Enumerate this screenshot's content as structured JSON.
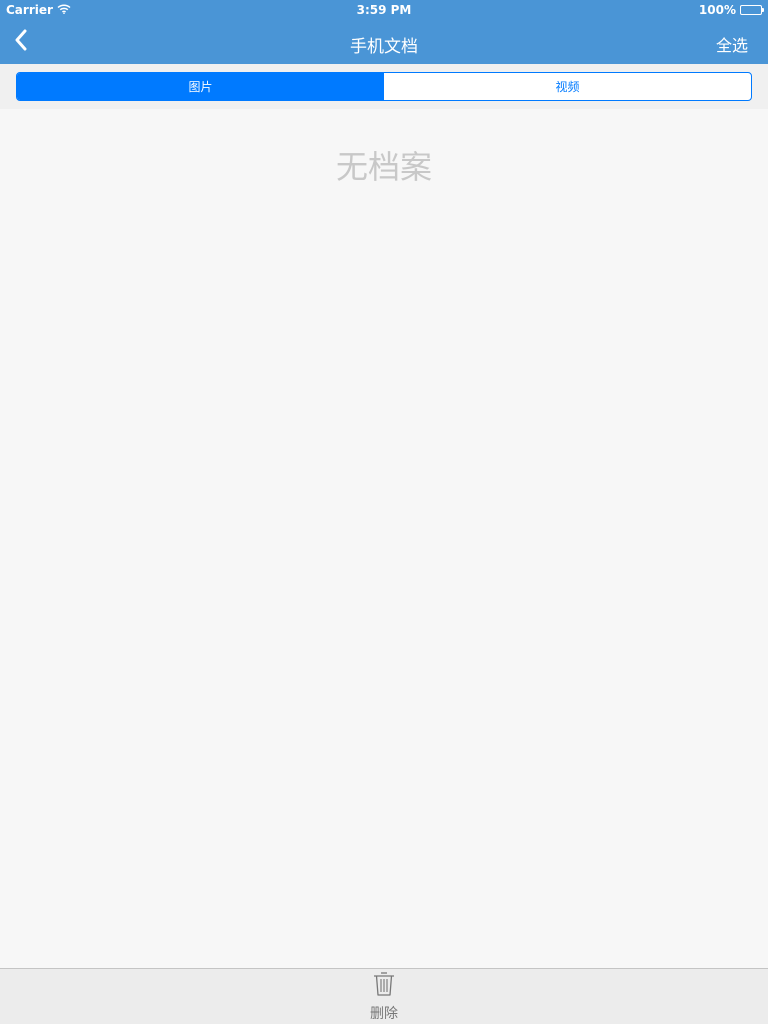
{
  "status_bar": {
    "carrier": "Carrier",
    "time": "3:59 PM",
    "battery_percent": "100%",
    "wifi_icon": "wifi-icon",
    "battery_icon": "battery-icon"
  },
  "nav": {
    "back_icon": "chevron-left-icon",
    "title": "手机文档",
    "right_action": "全选"
  },
  "segments": [
    {
      "label": "图片",
      "selected": true
    },
    {
      "label": "视频",
      "selected": false
    }
  ],
  "content": {
    "empty_message": "无档案"
  },
  "toolbar": {
    "delete_icon": "trash-icon",
    "delete_label": "删除"
  },
  "colors": {
    "nav_background": "#4a95d6",
    "segment_accent": "#007aff",
    "background": "#f7f7f7",
    "empty_text": "#c8c8c8"
  }
}
